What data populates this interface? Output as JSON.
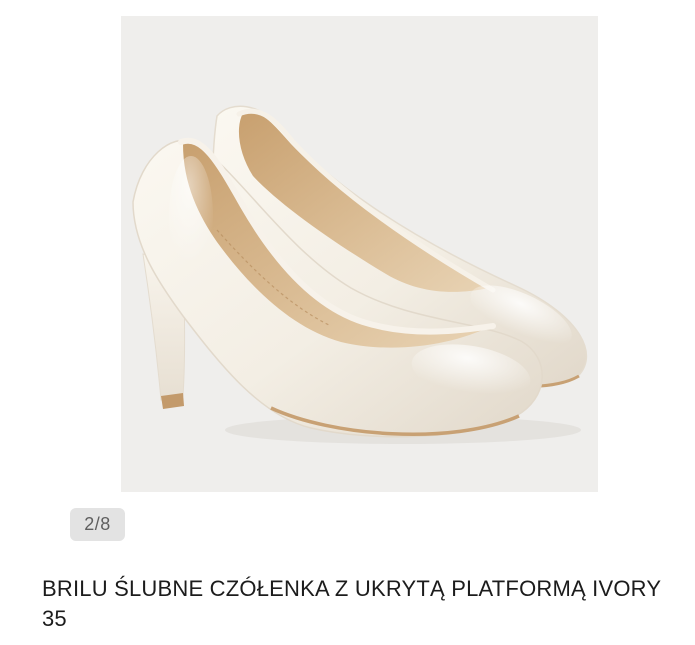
{
  "product": {
    "image_subject": "ivory-pumps",
    "gallery_counter": "2/8",
    "title": "BRILU ŚLUBNE CZÓŁENKA Z UKRYTĄ PLATFORMĄ IVORY 35"
  },
  "colors": {
    "image_background": "#efeeec",
    "shoe_ivory": "#f3eee4",
    "shoe_lining": "#d7b98f",
    "sole": "#c8a174",
    "counter_background": "#e3e3e3",
    "counter_text": "#5f5f5f",
    "title_text": "#1c1c1c"
  }
}
